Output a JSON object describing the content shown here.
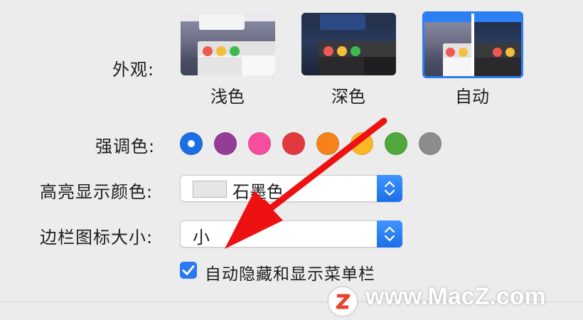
{
  "appearance": {
    "label": "外观:",
    "options": [
      {
        "label": "浅色",
        "selected": false
      },
      {
        "label": "深色",
        "selected": false
      },
      {
        "label": "自动",
        "selected": true
      }
    ]
  },
  "accent": {
    "label": "强调色:",
    "colors": [
      "#1a6fe6",
      "#953d96",
      "#f74f9e",
      "#e0393e",
      "#f7821b",
      "#fcb827",
      "#50a73c",
      "#8c8c8c"
    ],
    "selected_index": 0
  },
  "highlight": {
    "label": "高亮显示颜色:",
    "value": "石墨色",
    "swatch_color": "#e6e6e6"
  },
  "sidebar_icon_size": {
    "label": "边栏图标大小:",
    "value": "小"
  },
  "menubar_autohide": {
    "label": "自动隐藏和显示菜单栏",
    "checked": true
  },
  "watermark": {
    "text": "www.MacZ.com",
    "logo": "z-logo-icon"
  },
  "annotation": {
    "type": "red-arrow",
    "color": "#ee1111"
  }
}
